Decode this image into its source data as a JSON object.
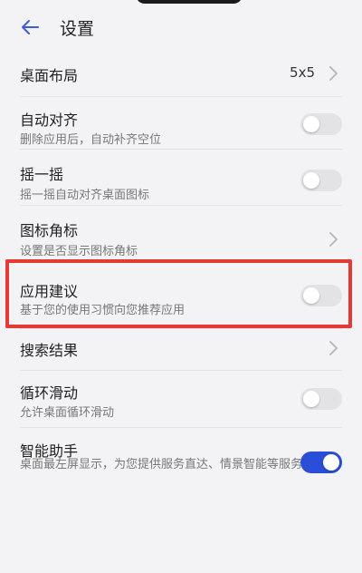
{
  "header": {
    "title": "设置"
  },
  "settings": [
    {
      "label": "桌面布局",
      "value": "5x5",
      "type": "chevron"
    },
    {
      "label": "自动对齐",
      "sub": "删除应用后，自动补齐空位",
      "type": "toggle",
      "on": false
    },
    {
      "label": "摇一摇",
      "sub": "摇一摇自动对齐桌面图标",
      "type": "toggle",
      "on": false
    },
    {
      "label": "图标角标",
      "sub": "设置是否显示图标角标",
      "type": "chevron"
    },
    {
      "label": "应用建议",
      "sub": "基于您的使用习惯向您推荐应用",
      "type": "toggle",
      "on": false,
      "highlighted": true
    },
    {
      "label": "搜索结果",
      "type": "chevron"
    },
    {
      "label": "循环滑动",
      "sub": "允许桌面循环滑动",
      "type": "toggle",
      "on": false
    },
    {
      "label": "智能助手",
      "sub": "桌面最左屏显示，为您提供服务直达、情景智能等服务",
      "type": "toggle",
      "on": true
    }
  ],
  "colors": {
    "accent": "#2b4ed8",
    "highlight_border": "#e53935",
    "toggle_off": "#e3e3e6"
  },
  "icons": {
    "back": "back-arrow-icon",
    "chevron": "chevron-right-icon"
  }
}
